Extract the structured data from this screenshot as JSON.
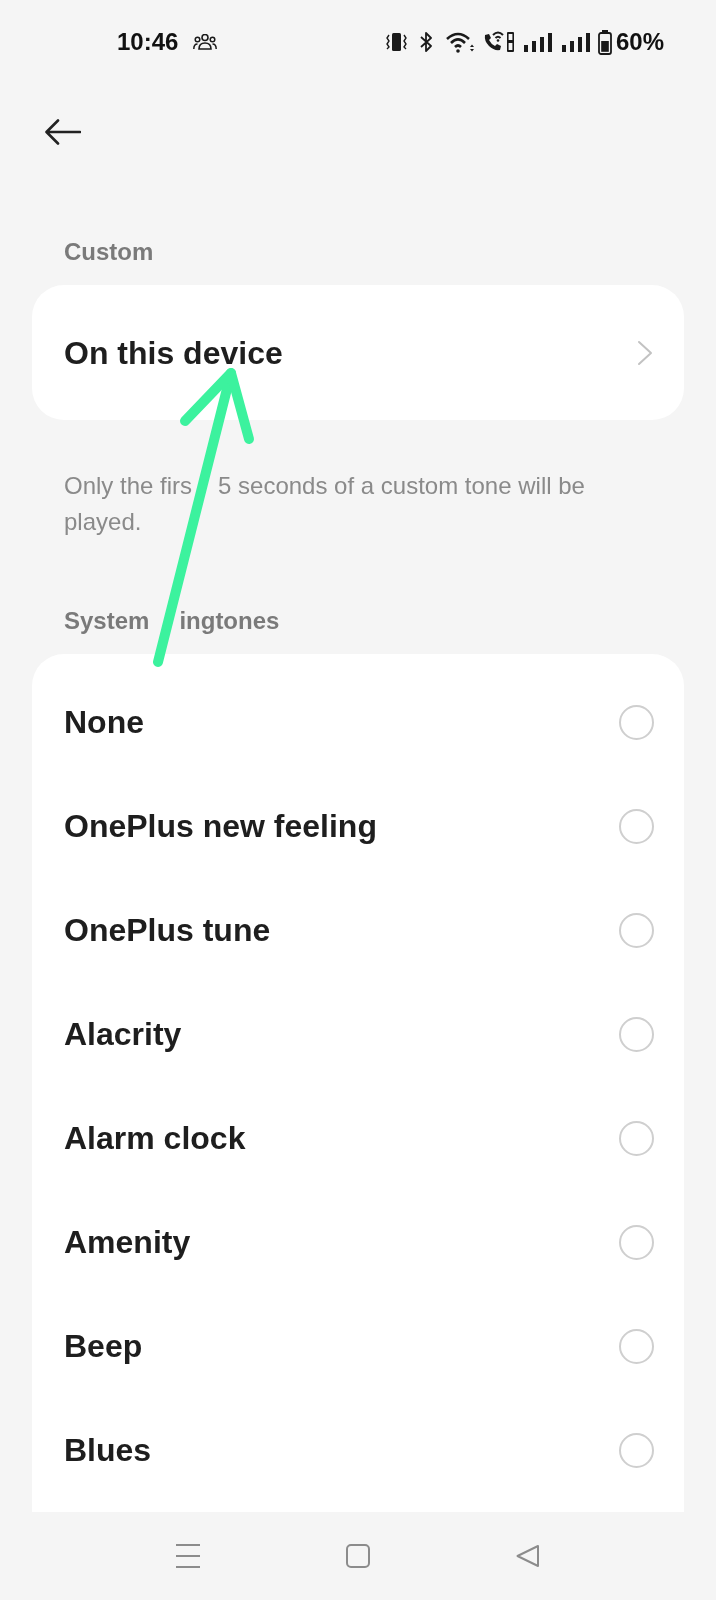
{
  "status_bar": {
    "time": "10:46",
    "battery": "60%"
  },
  "custom": {
    "title": "Custom",
    "item": "On this device",
    "note_fragments": [
      "Only the firs",
      "5 seconds of a custom tone will be",
      "played."
    ]
  },
  "system_ringtones": {
    "title_fragments": [
      "System",
      "ingtones"
    ],
    "options": [
      {
        "label": "None",
        "selected": false
      },
      {
        "label": "OnePlus new feeling",
        "selected": false
      },
      {
        "label": "OnePlus tune",
        "selected": false
      },
      {
        "label": "Alacrity",
        "selected": false
      },
      {
        "label": "Alarm clock",
        "selected": false
      },
      {
        "label": "Amenity",
        "selected": false
      },
      {
        "label": "Beep",
        "selected": false
      },
      {
        "label": "Blues",
        "selected": false
      }
    ]
  }
}
